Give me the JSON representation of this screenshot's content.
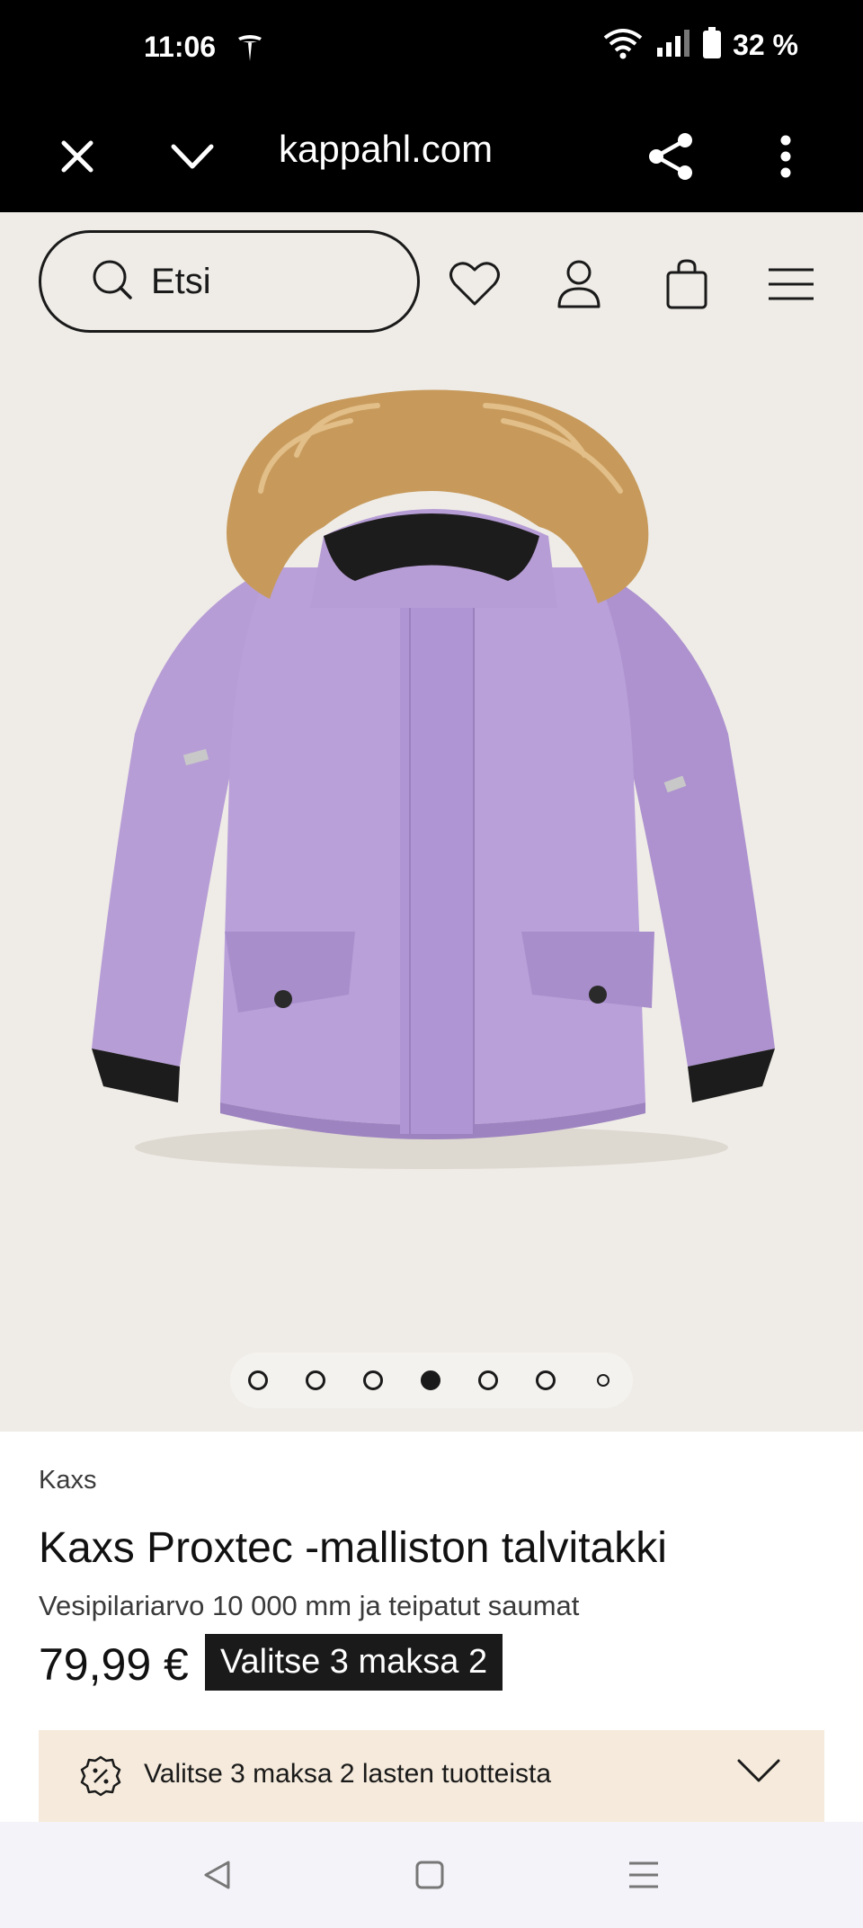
{
  "status_bar": {
    "time": "11:06",
    "battery": "32 %"
  },
  "browser": {
    "url": "kappahl.com"
  },
  "header": {
    "search_placeholder": "Etsi"
  },
  "product": {
    "brand": "Kaxs",
    "title": "Kaxs Proxtec -malliston talvitakki",
    "subtitle": "Vesipilariarvo 10 000 mm ja teipatut saumat",
    "price": "79,99 €",
    "promo_badge": "Valitse 3 maksa 2",
    "image_carousel": {
      "total": 7,
      "active_index": 4
    },
    "jacket_color": "#b69ad6"
  },
  "offer": {
    "text": "Valitse 3 maksa 2 lasten tuotteista"
  },
  "colors": {
    "header_bg": "#efece7",
    "offer_bg": "#f5eadb",
    "badge_bg": "#1a1a1a"
  }
}
